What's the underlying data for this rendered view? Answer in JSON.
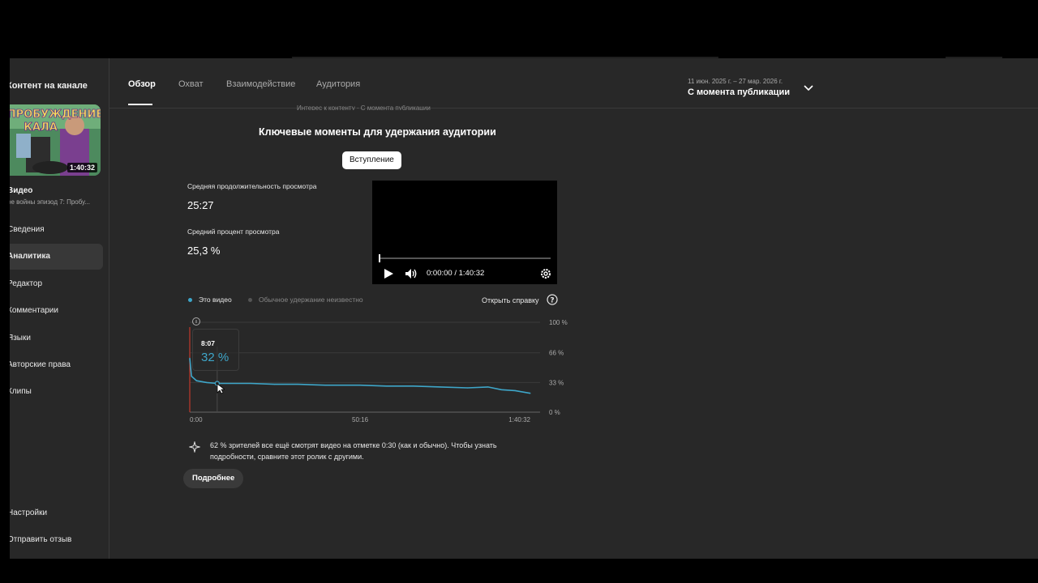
{
  "sidebar": {
    "heading": "Контент на канале",
    "thumbnail_title_art": "ПРОБУЖДЕНИЕ КАЛА",
    "thumbnail_duration": "1:40:32",
    "video_label": "Видео",
    "video_title": "ое войны эпизод 7: Пробу...",
    "items": [
      {
        "label": "Сведения",
        "icon": "info-icon"
      },
      {
        "label": "Аналитика",
        "icon": "analytics-icon",
        "active": true
      },
      {
        "label": "Редактор",
        "icon": "editor-icon"
      },
      {
        "label": "Комментарии",
        "icon": "comments-icon"
      },
      {
        "label": "Языки",
        "icon": "languages-icon"
      },
      {
        "label": "Авторские права",
        "icon": "copyright-icon"
      },
      {
        "label": "Клипы",
        "icon": "clips-icon"
      }
    ],
    "bottom_items": [
      {
        "label": "Настройки",
        "icon": "settings-icon"
      },
      {
        "label": "Отправить отзыв",
        "icon": "feedback-icon"
      }
    ]
  },
  "tabs": [
    {
      "label": "Обзор",
      "active": true
    },
    {
      "label": "Охват"
    },
    {
      "label": "Взаимодействие"
    },
    {
      "label": "Аудитория"
    }
  ],
  "date_selector": {
    "range": "11 июн. 2025 г. – 27 мар. 2026 г.",
    "preset": "С момента публикации"
  },
  "cut_subtitle": "Интерес к контенту · С момента публикации",
  "retention": {
    "title": "Ключевые моменты для удержания аудитории",
    "chip_label": "Вступление",
    "avg_duration_label": "Средняя продолжительность просмотра",
    "avg_duration_value": "25:27",
    "avg_percent_label": "Средний процент просмотра",
    "avg_percent_value": "25,3 %",
    "player_time": "0:00:00 / 1:40:32",
    "legend_this": "Это видео",
    "legend_typical": "Обычное удержание неизвестно",
    "help_link": "Открыть справку",
    "tooltip_time": "8:07",
    "tooltip_value": "32 %",
    "insight": "62 % зрителей все ещё смотрят видео на отметке 0:30 (как и обычно). Чтобы узнать подробности, сравните этот ролик с другими.",
    "more_button": "Подробнее"
  },
  "colors": {
    "accent_line": "#3ea6c9",
    "marker_red": "#c0392b",
    "page_bg": "#282828"
  },
  "chart_data": {
    "type": "line",
    "x_tick_labels": [
      "0:00",
      "50:16",
      "1:40:32"
    ],
    "y_tick_labels": [
      "100 %",
      "66 %",
      "33 %",
      "0 %"
    ],
    "ylim": [
      0,
      100
    ],
    "series": [
      {
        "name": "Это видео",
        "x_minutes": [
          0,
          0.5,
          2,
          5,
          8.1,
          12,
          18,
          25,
          32,
          40,
          50.3,
          58,
          66,
          74,
          82,
          88,
          92,
          96,
          100.5
        ],
        "values": [
          60,
          40,
          35,
          33,
          32,
          32,
          32,
          31,
          31,
          30,
          30,
          29,
          29,
          28,
          27,
          28,
          25,
          24,
          21
        ]
      }
    ],
    "grid": true
  }
}
